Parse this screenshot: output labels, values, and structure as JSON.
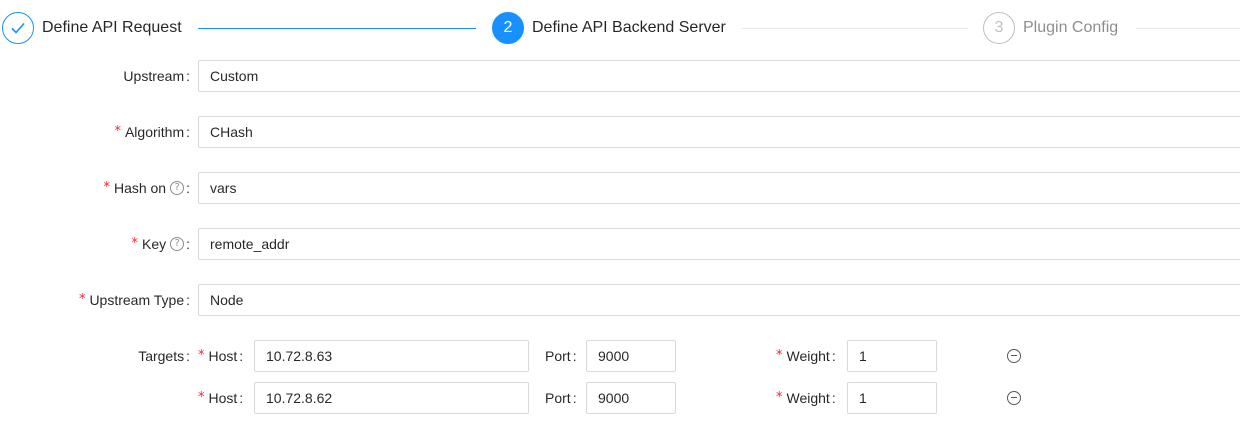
{
  "steps": [
    {
      "title": "Define API Request",
      "status": "finished",
      "icon": "check-icon"
    },
    {
      "title": "Define API Backend Server",
      "number": "2",
      "status": "active"
    },
    {
      "title": "Plugin Config",
      "number": "3",
      "status": "waiting"
    }
  ],
  "form": {
    "colon": ":",
    "required_mark": "*",
    "upstream": {
      "label": "Upstream",
      "value": "Custom"
    },
    "algorithm": {
      "label": "Algorithm",
      "value": "CHash"
    },
    "hash_on": {
      "label": "Hash on",
      "value": "vars",
      "help_icon": "question-circle-icon"
    },
    "key": {
      "label": "Key",
      "value": "remote_addr",
      "help_icon": "question-circle-icon"
    },
    "upstream_type": {
      "label": "Upstream Type",
      "value": "Node"
    },
    "targets": {
      "label": "Targets",
      "host_label": "Host",
      "port_label": "Port",
      "weight_label": "Weight",
      "rows": [
        {
          "host": "10.72.8.63",
          "port": "9000",
          "weight": "1"
        },
        {
          "host": "10.72.8.62",
          "port": "9000",
          "weight": "1"
        }
      ]
    }
  },
  "colors": {
    "primary": "#1890ff",
    "required": "#f5222d",
    "border": "#d9d9d9"
  }
}
